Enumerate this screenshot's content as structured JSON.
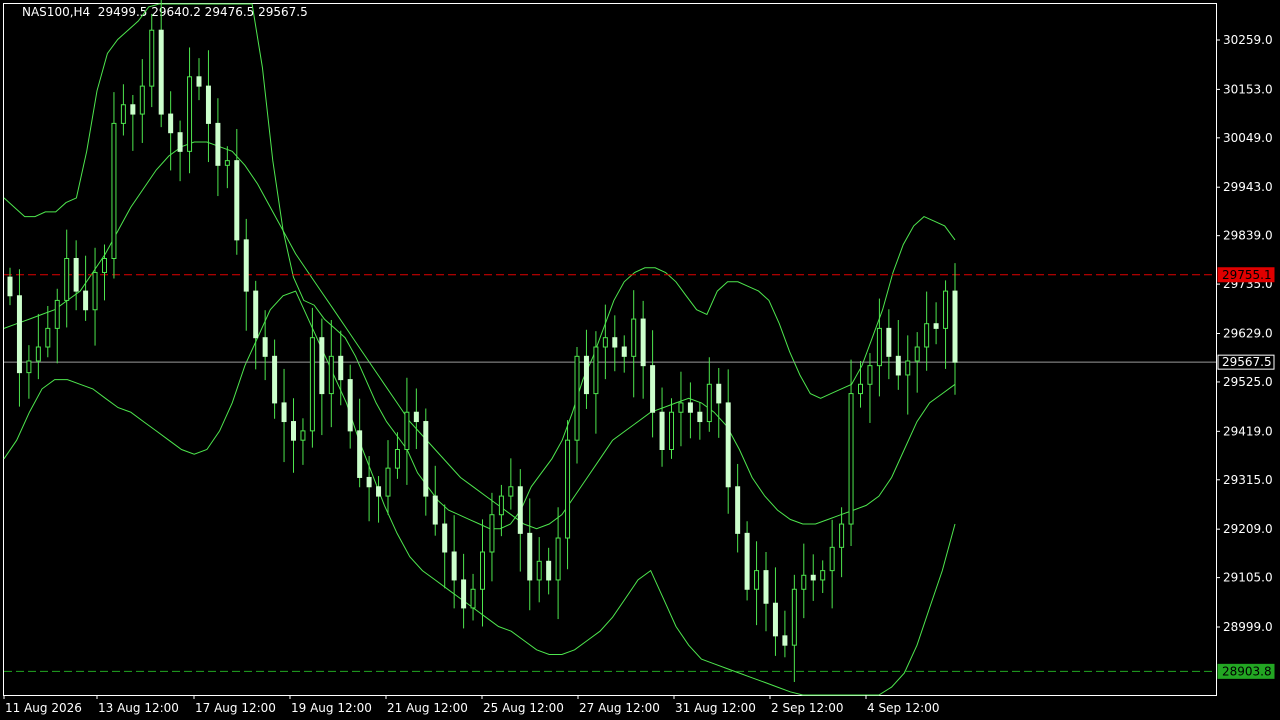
{
  "header": {
    "title": "NAS100,H4  29499.5 29640.2 29476.5 29567.5"
  },
  "colors": {
    "background": "#000000",
    "frame": "#ffffff",
    "candle": "#ccffcc",
    "wick": "#4ee64e",
    "bands": "#4ee64e",
    "resistance": "#e00000",
    "support": "#23a623",
    "current": "#9a9a9a"
  },
  "chart_data": {
    "type": "candlestick",
    "symbol": "NAS100",
    "timeframe": "H4",
    "ohlc_label": "29499.5 29640.2 29476.5 29567.5",
    "ylim": [
      28880,
      30320
    ],
    "y_ticks": [
      "30259.0",
      "30153.0",
      "30049.0",
      "29943.0",
      "29839.0",
      "29735.0",
      "29629.0",
      "29525.0",
      "29419.0",
      "29315.0",
      "29209.0",
      "29105.0",
      "28999.0"
    ],
    "x_ticks": [
      "11 Aug 2026",
      "13 Aug 12:00",
      "17 Aug 12:00",
      "19 Aug 12:00",
      "21 Aug 12:00",
      "25 Aug 12:00",
      "27 Aug 12:00",
      "31 Aug 12:00",
      "2 Sep 12:00",
      "4 Sep 12:00"
    ],
    "price_tags": {
      "resistance": "29755.1",
      "current": "29567.5",
      "support": "28903.8"
    },
    "closes": [
      29710,
      29545,
      29570,
      29600,
      29640,
      29700,
      29790,
      29720,
      29680,
      29760,
      29790,
      30080,
      30120,
      30100,
      30160,
      30280,
      30100,
      30060,
      30020,
      30180,
      30160,
      30080,
      29990,
      30000,
      29830,
      29720,
      29620,
      29580,
      29480,
      29440,
      29400,
      29420,
      29620,
      29500,
      29580,
      29530,
      29420,
      29320,
      29300,
      29280,
      29340,
      29380,
      29460,
      29440,
      29280,
      29220,
      29160,
      29100,
      29040,
      29080,
      29160,
      29240,
      29280,
      29300,
      29200,
      29100,
      29140,
      29100,
      29190,
      29400,
      29580,
      29500,
      29600,
      29620,
      29600,
      29580,
      29660,
      29560,
      29460,
      29380,
      29460,
      29480,
      29460,
      29440,
      29520,
      29480,
      29300,
      29200,
      29080,
      29120,
      29050,
      28980,
      28960,
      29080,
      29110,
      29100,
      29120,
      29170,
      29220,
      29500,
      29520,
      29560,
      29640,
      29580,
      29540,
      29570,
      29600,
      29650,
      29640,
      29720,
      29567.5
    ],
    "band_upper": [
      29920,
      29900,
      29880,
      29880,
      29890,
      29890,
      29910,
      29920,
      30020,
      30150,
      30230,
      30260,
      30280,
      30300,
      30330,
      30340,
      30350,
      30360,
      30370,
      30380,
      30390,
      30400,
      30410,
      30420,
      30350,
      30200,
      30000,
      29850,
      29750,
      29700,
      29690,
      29660,
      29640,
      29620,
      29580,
      29530,
      29480,
      29440,
      29410,
      29380,
      29330,
      29300,
      29270,
      29250,
      29240,
      29230,
      29220,
      29210,
      29210,
      29220,
      29250,
      29300,
      29330,
      29360,
      29400,
      29460,
      29530,
      29580,
      29640,
      29700,
      29740,
      29760,
      29770,
      29770,
      29760,
      29740,
      29710,
      29680,
      29670,
      29720,
      29740,
      29740,
      29730,
      29720,
      29700,
      29650,
      29590,
      29540,
      29500,
      29490,
      29500,
      29510,
      29520,
      29560,
      29620,
      29680,
      29760,
      29820,
      29860,
      29880,
      29870,
      29860,
      29830
    ],
    "band_middle": [
      29640,
      29650,
      29660,
      29670,
      29680,
      29700,
      29720,
      29760,
      29800,
      29850,
      29900,
      29940,
      29980,
      30010,
      30030,
      30040,
      30040,
      30030,
      30020,
      29990,
      29950,
      29900,
      29850,
      29800,
      29760,
      29720,
      29680,
      29640,
      29600,
      29560,
      29520,
      29480,
      29440,
      29410,
      29380,
      29350,
      29320,
      29300,
      29280,
      29260,
      29240,
      29220,
      29210,
      29220,
      29240,
      29280,
      29320,
      29360,
      29400,
      29420,
      29440,
      29460,
      29470,
      29480,
      29490,
      29480,
      29460,
      29430,
      29380,
      29320,
      29280,
      29250,
      29230,
      29220,
      29220,
      29230,
      29240,
      29250,
      29260,
      29280,
      29320,
      29380,
      29440,
      29480,
      29500,
      29520
    ],
    "band_lower": [
      29360,
      29400,
      29460,
      29510,
      29530,
      29530,
      29520,
      29510,
      29490,
      29470,
      29460,
      29440,
      29420,
      29400,
      29380,
      29370,
      29380,
      29420,
      29480,
      29560,
      29620,
      29680,
      29710,
      29720,
      29660,
      29600,
      29540,
      29480,
      29400,
      29330,
      29260,
      29200,
      29150,
      29120,
      29100,
      29080,
      29060,
      29040,
      29020,
      29000,
      28990,
      28970,
      28950,
      28940,
      28940,
      28950,
      28970,
      28990,
      29020,
      29060,
      29100,
      29120,
      29060,
      29000,
      28960,
      28930,
      28920,
      28910,
      28900,
      28890,
      28880,
      28870,
      28860,
      28850,
      28840,
      28830,
      28820,
      28820,
      28830,
      28850,
      28870,
      28900,
      28960,
      29040,
      29120,
      29220
    ]
  }
}
